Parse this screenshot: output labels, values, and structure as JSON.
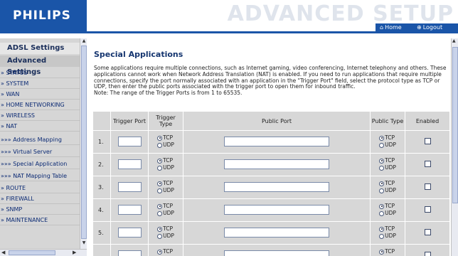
{
  "brand": {
    "logo": "PHILIPS",
    "banner_title": "ADVANCED SETUP"
  },
  "nav": {
    "home": "Home",
    "logout": "Logout"
  },
  "sidebar": {
    "sections": [
      "ADSL Settings",
      "Advanced Settings"
    ],
    "items": [
      "» STATUS",
      "» SYSTEM",
      "» WAN",
      "» HOME NETWORKING",
      "» WIRELESS",
      "» NAT",
      "»»» Address Mapping",
      "»»» Virtual Server",
      "»»» Special Application",
      "»»» NAT Mapping Table",
      "» ROUTE",
      "» FIREWALL",
      "» SNMP",
      "» MAINTENANCE"
    ]
  },
  "main": {
    "title": "Special Applications",
    "description": "Some applications require multiple connections, such as Internet gaming, video conferencing, Internet telephony and others. These applications cannot work when Network Address Translation (NAT) is enabled. If you need to run applications that require multiple connections, specify the port normally associated with an application in the \"Trigger Port\" field, select the protocol type as TCP or UDP, then enter the public ports associated with the trigger port to open them for inbound traffic.",
    "note": "Note: The range of the Trigger Ports is from 1 to 65535.",
    "columns": [
      "",
      "Trigger Port",
      "Trigger Type",
      "Public Port",
      "Public Type",
      "Enabled"
    ],
    "rows": [
      {
        "num": "1."
      },
      {
        "num": "2."
      },
      {
        "num": "3."
      },
      {
        "num": "4."
      },
      {
        "num": "5."
      },
      {
        "num": ""
      }
    ],
    "tcp_label": "TCP",
    "udp_label": "UDP"
  },
  "colors": {
    "accent": "#1a55a8",
    "sidebar_bg": "#d6d6d6",
    "table_cell": "#d7d7d7",
    "title": "#15356f"
  }
}
